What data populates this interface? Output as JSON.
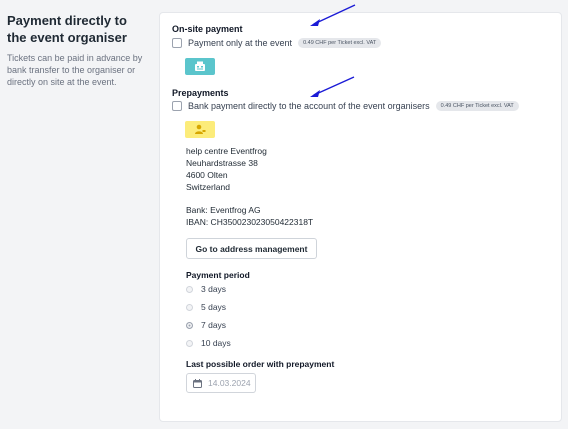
{
  "left": {
    "title": "Payment directly to the event organiser",
    "description": "Tickets can be paid in advance by bank transfer to the organiser or directly on site at the event."
  },
  "onsite": {
    "heading": "On-site payment",
    "checkbox_label": "Payment only at the event",
    "fee": "0.49 CHF per Ticket excl. VAT",
    "icon": "cash-register-icon"
  },
  "prepayments": {
    "heading": "Prepayments",
    "checkbox_label": "Bank payment directly to the account of the event organisers",
    "fee": "0.49 CHF per Ticket excl. VAT",
    "icon": "bank-user-icon",
    "address_lines": [
      "help centre Eventfrog",
      "Neuhardstrasse 38",
      "4600 Olten",
      "Switzerland"
    ],
    "bank": "Bank: Eventfrog AG",
    "iban": "IBAN: CH350023023050422318T",
    "address_button": "Go to address management"
  },
  "payment_period": {
    "label": "Payment period",
    "options": [
      "3 days",
      "5 days",
      "7 days",
      "10 days"
    ],
    "selected": "7 days"
  },
  "last_order": {
    "label": "Last possible order with prepayment",
    "date": "14.03.2024"
  },
  "colors": {
    "arrow": "#1b1bd6",
    "teal_icon_bg": "#5bc5cc",
    "yellow_icon_bg": "#fcec7a"
  }
}
